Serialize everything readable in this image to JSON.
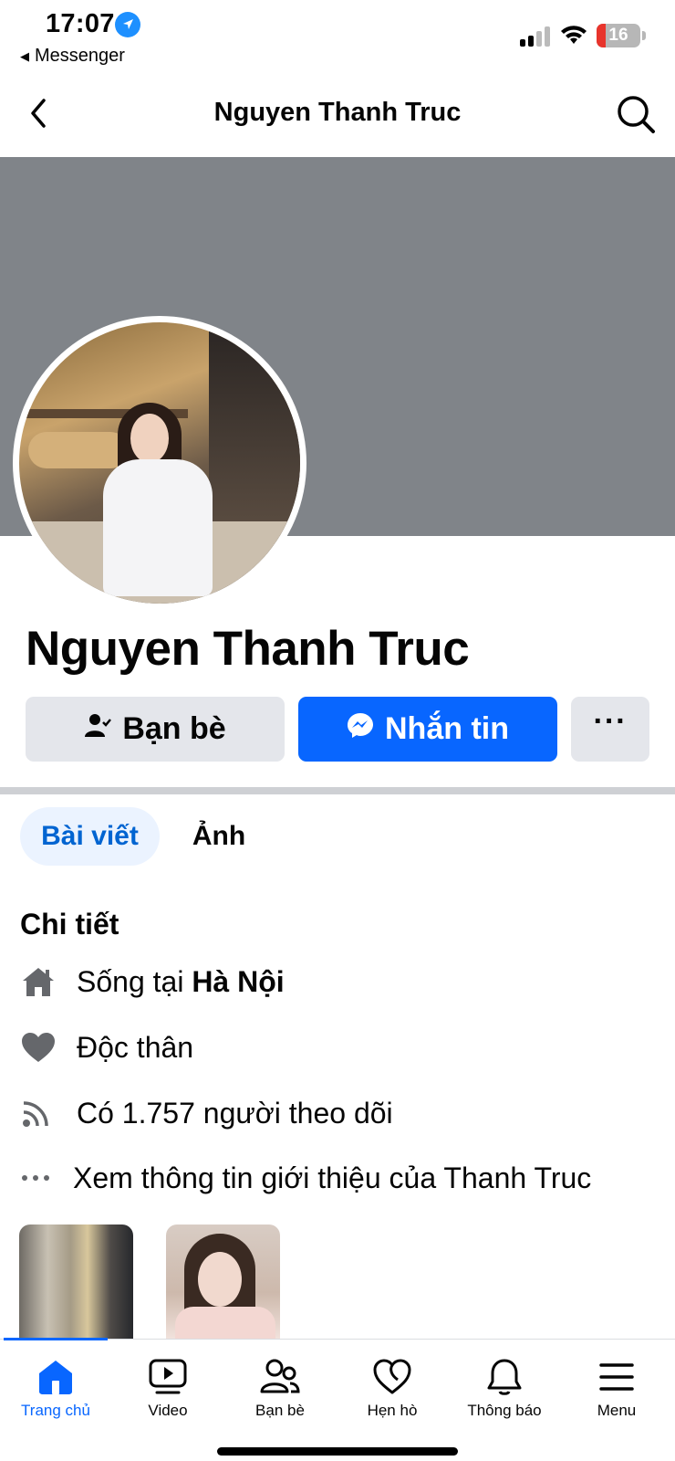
{
  "status_bar": {
    "time": "17:07",
    "back_app": "Messenger",
    "battery": "16"
  },
  "header": {
    "title": "Nguyen Thanh Truc"
  },
  "profile": {
    "name": "Nguyen Thanh Truc"
  },
  "actions": {
    "friends_label": "Bạn bè",
    "message_label": "Nhắn tin",
    "more_label": "···"
  },
  "tabs": [
    {
      "label": "Bài viết",
      "active": true
    },
    {
      "label": "Ảnh",
      "active": false
    }
  ],
  "details": {
    "title": "Chi tiết",
    "lives_prefix": "Sống tại ",
    "lives_city": "Hà Nội",
    "relationship": "Độc thân",
    "followers": "Có 1.757 người theo dõi",
    "see_about": "Xem thông tin giới thiệu của Thanh Truc"
  },
  "bottom_nav": [
    {
      "label": "Trang chủ",
      "icon": "home-icon",
      "active": true
    },
    {
      "label": "Video",
      "icon": "video-icon",
      "active": false
    },
    {
      "label": "Bạn bè",
      "icon": "friends-icon",
      "active": false
    },
    {
      "label": "Hẹn hò",
      "icon": "dating-icon",
      "active": false
    },
    {
      "label": "Thông báo",
      "icon": "bell-icon",
      "active": false
    },
    {
      "label": "Menu",
      "icon": "menu-icon",
      "active": false
    }
  ],
  "colors": {
    "accent": "#0866ff",
    "cover": "#808489",
    "button_gray": "#e4e6eb"
  }
}
